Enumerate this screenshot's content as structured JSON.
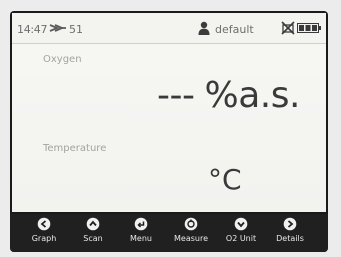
{
  "status_bar": {
    "time": "14:47",
    "sensor_icon": "sensor-probe-icon",
    "sensor_number": "51",
    "user_icon": "user-icon",
    "user_name": "default",
    "usb_icon": "no-usb-icon",
    "battery_icon": "battery-icon"
  },
  "readings": {
    "oxygen": {
      "label": "Oxygen",
      "value": "---",
      "unit": "%a.s."
    },
    "temperature": {
      "label": "Temperature",
      "value": "",
      "unit": "°C"
    }
  },
  "soft_keys": [
    {
      "label": "Graph",
      "icon": "circle-arrow-left-icon"
    },
    {
      "label": "Scan",
      "icon": "circle-arrow-up-icon"
    },
    {
      "label": "Menu",
      "icon": "circle-return-icon"
    },
    {
      "label": "Measure",
      "icon": "circle-measure-icon"
    },
    {
      "label": "O2 Unit",
      "icon": "circle-arrow-down-icon"
    },
    {
      "label": "Details",
      "icon": "circle-arrow-right-icon"
    }
  ],
  "colors": {
    "screen_background": "#f5f5f2",
    "soft_key_bar": "#202020",
    "value_text": "#3a3a3a",
    "label_text": "#a3a3a3"
  }
}
